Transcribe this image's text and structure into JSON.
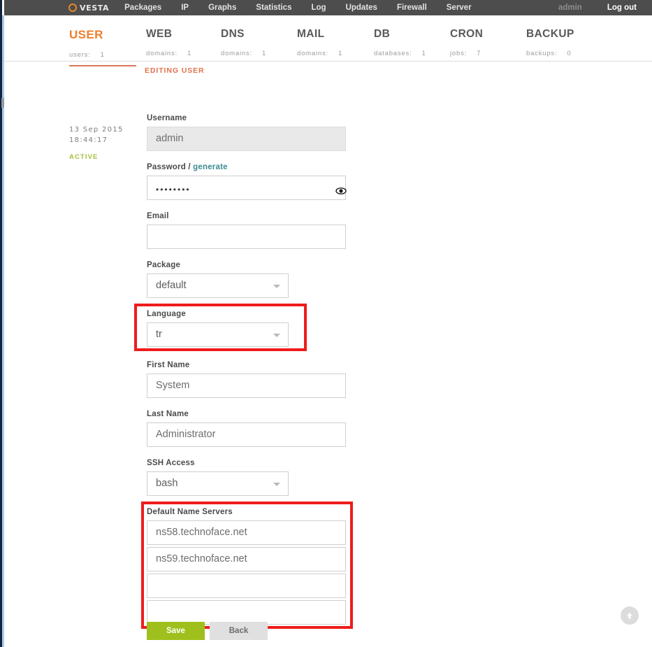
{
  "topnav": {
    "brand": "VESTA",
    "brand_icon": "circle-logo-icon",
    "items": [
      {
        "label": "Packages"
      },
      {
        "label": "IP"
      },
      {
        "label": "Graphs"
      },
      {
        "label": "Statistics"
      },
      {
        "label": "Log"
      },
      {
        "label": "Updates"
      },
      {
        "label": "Firewall"
      },
      {
        "label": "Server"
      }
    ],
    "user": "admin",
    "logout": "Log out"
  },
  "statbar": {
    "tabs": [
      {
        "title": "USER",
        "sub": "users:",
        "count": "1",
        "active": true
      },
      {
        "title": "WEB",
        "sub": "domains:",
        "count": "1",
        "active": false
      },
      {
        "title": "DNS",
        "sub": "domains:",
        "count": "1",
        "active": false
      },
      {
        "title": "MAIL",
        "sub": "domains:",
        "count": "1",
        "active": false
      },
      {
        "title": "DB",
        "sub": "databases:",
        "count": "1",
        "active": false
      },
      {
        "title": "CRON",
        "sub": "jobs:",
        "count": "7",
        "active": false
      },
      {
        "title": "BACKUP",
        "sub": "backups:",
        "count": "0",
        "active": false
      }
    ]
  },
  "page": {
    "editing_label": "EDITING USER"
  },
  "meta": {
    "date": "13 Sep 2015",
    "time": "18:44:17",
    "status": "ACTIVE"
  },
  "form": {
    "username": {
      "label": "Username",
      "value": "admin"
    },
    "password": {
      "label": "Password",
      "separator": "/",
      "generate_link": "generate",
      "value": "••••••••",
      "reveal_icon": "eye-icon"
    },
    "email": {
      "label": "Email",
      "value": "",
      "placeholder": ""
    },
    "package": {
      "label": "Package",
      "value": "default"
    },
    "language": {
      "label": "Language",
      "value": "tr",
      "highlighted": true
    },
    "first_name": {
      "label": "First Name",
      "value": "System"
    },
    "last_name": {
      "label": "Last Name",
      "value": "Administrator"
    },
    "ssh_access": {
      "label": "SSH Access",
      "value": "bash"
    },
    "name_servers": {
      "label": "Default Name Servers",
      "highlighted": true,
      "values": [
        "ns58.technoface.net",
        "ns59.technoface.net",
        "",
        ""
      ]
    }
  },
  "actions": {
    "save": "Save",
    "back": "Back"
  },
  "scroll_top": {
    "icon": "arrow-up-icon"
  },
  "colors": {
    "accent_orange": "#f07e2a",
    "nav_bg": "#4d4d4d",
    "highlight_red": "#ee1c1c",
    "save_green": "#9fc01c",
    "status_green": "#a4bf3c",
    "link_teal": "#3c8c93"
  }
}
